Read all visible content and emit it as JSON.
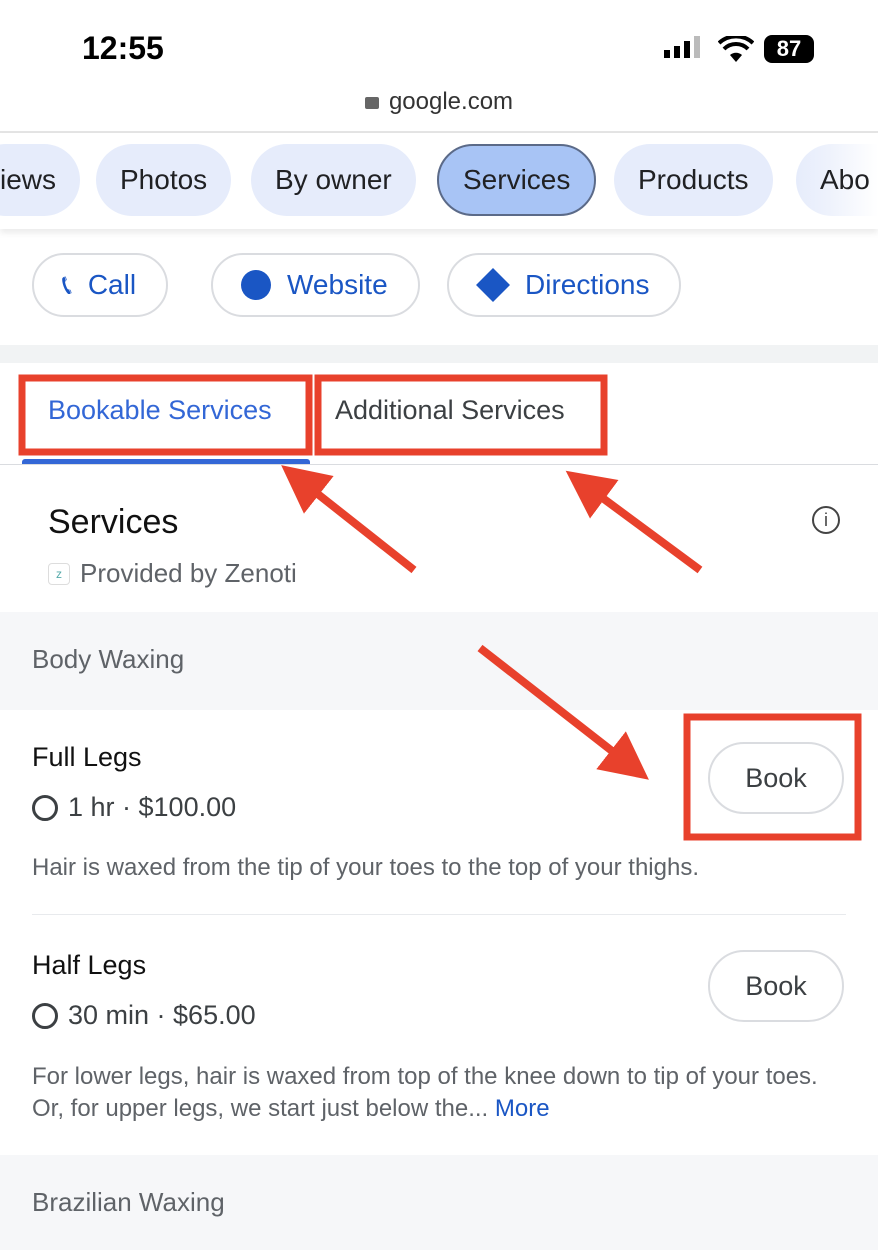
{
  "status_bar": {
    "time": "12:55",
    "battery": "87"
  },
  "browser": {
    "url": "google.com"
  },
  "chips": [
    "iews",
    "Photos",
    "By owner",
    "Services",
    "Products",
    "Abo"
  ],
  "actions": {
    "call": "Call",
    "website": "Website",
    "directions": "Directions"
  },
  "tabs": [
    "Bookable Services",
    "Additional Services"
  ],
  "services": {
    "title": "Services",
    "provider": "Provided by Zenoti",
    "categories": [
      {
        "name": "Body Waxing",
        "items": [
          {
            "name": "Full Legs",
            "meta": "1 hr · $100.00",
            "desc": "Hair is waxed from the tip of your toes to the top of your thighs.",
            "book": "Book"
          },
          {
            "name": "Half Legs",
            "meta": "30 min · $65.00",
            "desc": "For lower legs, hair is waxed from top of the knee down to tip of your toes. Or, for upper legs, we start just below the...",
            "more": "More",
            "book": "Book"
          }
        ]
      },
      {
        "name": "Brazilian Waxing"
      }
    ]
  },
  "colors": {
    "accent": "#3367d6",
    "annotation": "#e8412c"
  }
}
